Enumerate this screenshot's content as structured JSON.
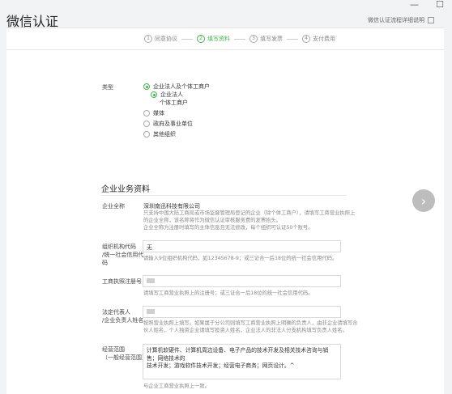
{
  "window": {
    "minimize": "—",
    "maximize": "☐"
  },
  "page": {
    "title": "微信认证",
    "help_link": "微信认证流程详细说明"
  },
  "steps": [
    {
      "num": "1",
      "label": "同意协议"
    },
    {
      "num": "2",
      "label": "填写资料"
    },
    {
      "num": "3",
      "label": "填写发票"
    },
    {
      "num": "4",
      "label": "支付费用"
    }
  ],
  "type_section": {
    "label": "类型",
    "option_main": "企业法人及个体工商户",
    "sub_option_1": "企业法人",
    "sub_option_2": "个体工商户",
    "option_media": "媒体",
    "option_gov": "政府及事业单位",
    "option_other": "其他组织"
  },
  "enterprise": {
    "section_title": "企业业务资料",
    "full_name_label": "企业全称",
    "full_name_value": "深圳南迅科技有限公司",
    "full_name_desc": [
      "只支持中国大陆工商局或市场监督管理局登记的企业（除个体工商户），请填写工商营业执照上",
      "的企业全称，该名称将作为微信认证审核服务费的发票抬头。",
      "企业全称为注册时填写的主体信息且无法修改，每个组织可认证50个账号。"
    ],
    "org_code_label_1": "组织机构代码",
    "org_code_label_2": "/统一社会信用代",
    "org_code_label_3": "码",
    "org_code_value": "无",
    "org_code_desc": "请输入9位组织机构代码，如12345678-9；或三证合一后18位的统一社会信用代码。",
    "reg_no_label": "工商执照注册号",
    "reg_no_desc": "请填写工商营业执照上的注册号；或三证合一后18位的统一社会信用代码。",
    "legal_label_1": "法定代表人",
    "legal_label_2": "/企业负责人姓名",
    "legal_desc": [
      "按照营业执照上填写。如果属于分公司则填写工商营业执照上明确的负责人，由非企业请填写合",
      "伙人姓名，个人独资企业请填写投资人姓名，企业法人的非法人分支机构填写负责人姓名。"
    ],
    "scope_label_1": "经营范围",
    "scope_label_2": "（一般经营范围）",
    "scope_value": [
      "计算机软硬件、计算机周边设备、电子产品的技术开发及相关技术咨询与销售；网络技术的",
      "技术开发；游戏软件技术开发；经营电子商务；网页设计。^"
    ],
    "scope_desc": "与企业工商营业执照上一致。"
  },
  "next_button": {
    "label": "›"
  }
}
